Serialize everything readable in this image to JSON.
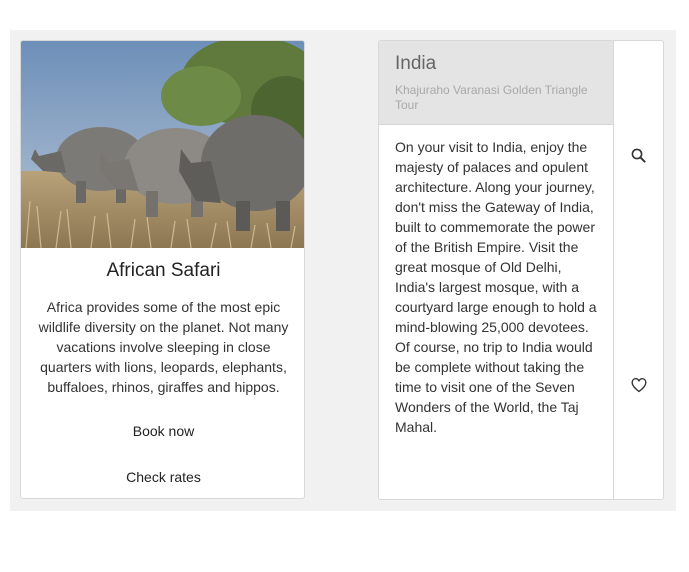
{
  "card_safari": {
    "image_icon": "rhinos-photo",
    "title": "African Safari",
    "description": "Africa provides some of the most epic wildlife diversity on the planet. Not many vacations involve sleeping in close quarters with lions, leopards, elephants, buffaloes, rhinos, giraffes and hippos.",
    "book_label": "Book now",
    "rates_label": "Check rates"
  },
  "card_india": {
    "title": "India",
    "subtitle": "Khajuraho Varanasi Golden Triangle Tour",
    "body": "On your visit to India, enjoy the majesty of palaces and opulent architecture. Along your journey, don't miss the Gateway of India, built to commemorate the power of the British Empire. Visit the great mosque of Old Delhi, India's largest mosque, with a courtyard large enough to hold a mind-blowing 25,000 devotees. Of course, no trip to India would be complete without taking the time to visit one of the Seven Wonders of the World, the Taj Mahal.",
    "icons": [
      "search-icon",
      "heart-icon"
    ]
  },
  "colors": {
    "background_panel": "#f1f1f1",
    "card_border": "#d8d8d8",
    "header_fill": "#e4e4e4"
  }
}
